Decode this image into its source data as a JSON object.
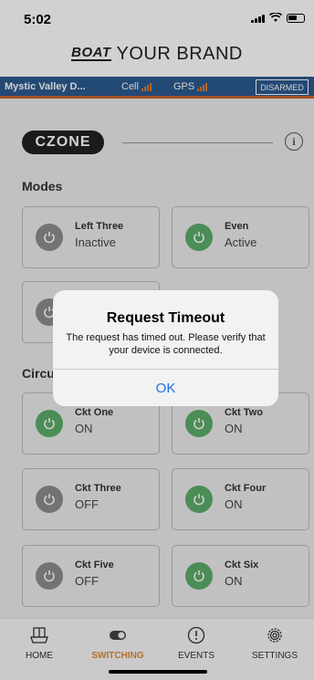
{
  "status_bar": {
    "time": "5:02"
  },
  "brand": {
    "logo": "BOAT",
    "title": "YOUR BRAND"
  },
  "info_bar": {
    "boat_name": "Mystic Valley D...",
    "cell_label": "Cell",
    "gps_label": "GPS",
    "alarm_button": "DISARMED"
  },
  "czone": {
    "logo": "CZONE"
  },
  "modes": {
    "title": "Modes",
    "items": [
      {
        "name": "Left Three",
        "state": "Inactive",
        "on": false
      },
      {
        "name": "Even",
        "state": "Active",
        "on": true
      },
      {
        "name": "",
        "state": "",
        "on": false
      }
    ]
  },
  "circuits": {
    "title": "Circu",
    "items": [
      {
        "name": "Ckt One",
        "state": "ON",
        "on": true
      },
      {
        "name": "Ckt Two",
        "state": "ON",
        "on": true
      },
      {
        "name": "Ckt Three",
        "state": "OFF",
        "on": false
      },
      {
        "name": "Ckt Four",
        "state": "ON",
        "on": true
      },
      {
        "name": "Ckt Five",
        "state": "OFF",
        "on": false
      },
      {
        "name": "Ckt Six",
        "state": "ON",
        "on": true
      }
    ]
  },
  "dialog": {
    "title": "Request Timeout",
    "message": "The request has timed out. Please verify that your device is connected.",
    "ok": "OK"
  },
  "tabs": [
    {
      "label": "HOME",
      "icon": "home-dock-icon",
      "active": false
    },
    {
      "label": "SWITCHING",
      "icon": "toggle-icon",
      "active": true
    },
    {
      "label": "EVENTS",
      "icon": "alert-icon",
      "active": false
    },
    {
      "label": "SETTINGS",
      "icon": "gear-icon",
      "active": false
    }
  ],
  "colors": {
    "info_bar": "#2b5a8f",
    "accent_orange": "#d88a3a",
    "power_on": "#5cad6a",
    "power_off": "#8d8d8d",
    "dialog_button": "#1a6fd8"
  }
}
